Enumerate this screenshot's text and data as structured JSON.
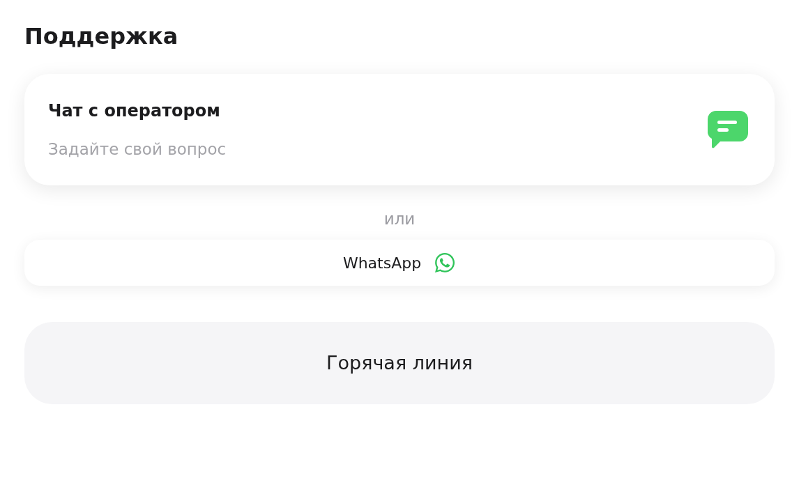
{
  "title": "Поддержка",
  "chat_card": {
    "title": "Чат с оператором",
    "subtitle": "Задайте свой вопрос"
  },
  "separator": "или",
  "whatsapp_button": {
    "label": "WhatsApp"
  },
  "hotline_button": {
    "label": "Горячая линия"
  }
}
